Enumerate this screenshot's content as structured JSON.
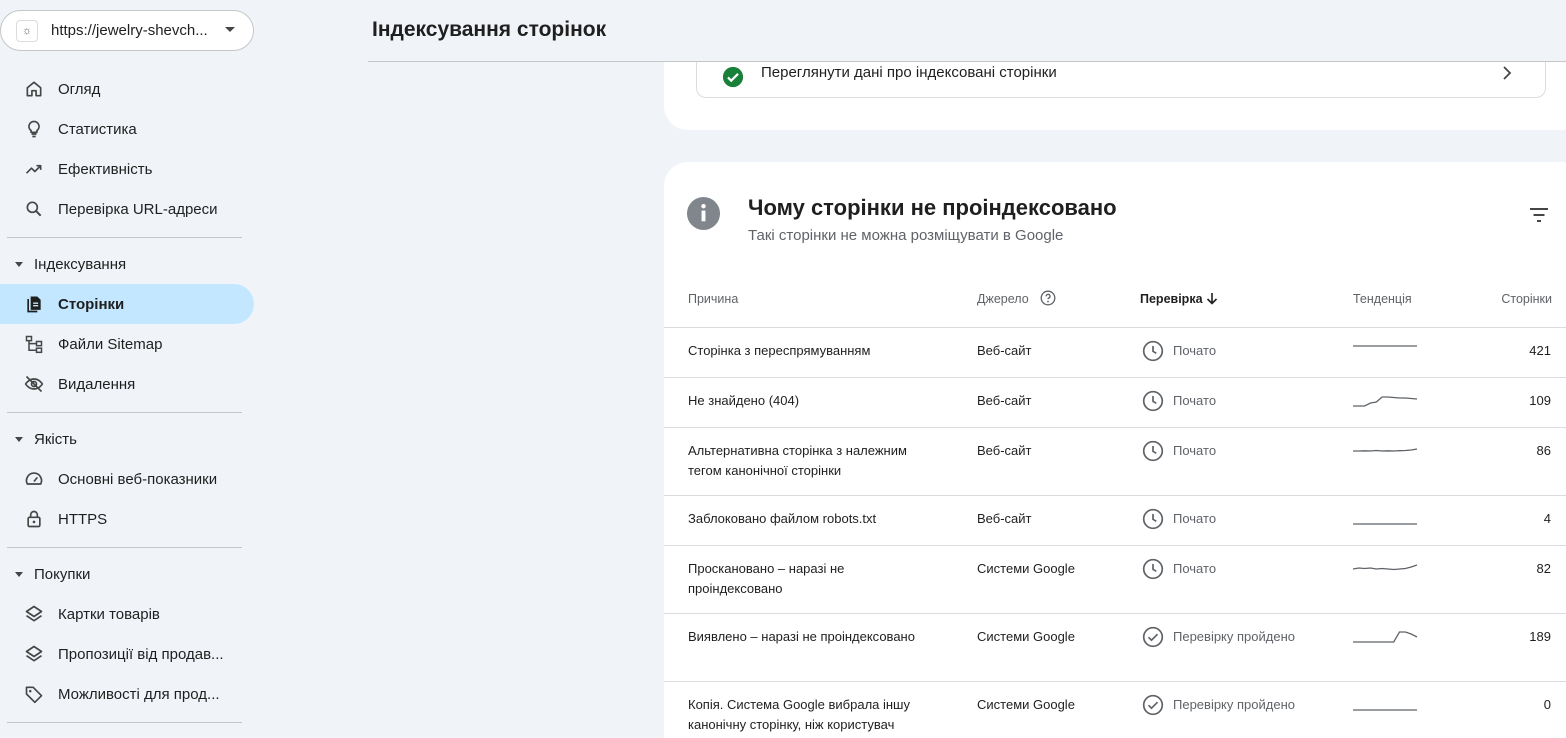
{
  "property": {
    "url": "https://jewelry-shevch...",
    "favicon": "☼"
  },
  "sidebar": {
    "items": [
      {
        "label": "Огляд",
        "icon": "home-icon"
      },
      {
        "label": "Статистика",
        "icon": "lightbulb-icon"
      },
      {
        "label": "Ефективність",
        "icon": "trending-up-icon"
      },
      {
        "label": "Перевірка URL-адреси",
        "icon": "search-icon"
      }
    ],
    "sections": [
      {
        "label": "Індексування",
        "items": [
          {
            "label": "Сторінки",
            "icon": "pages-icon",
            "active": true
          },
          {
            "label": "Файли Sitemap",
            "icon": "sitemap-icon"
          },
          {
            "label": "Видалення",
            "icon": "visibility-off-icon"
          }
        ]
      },
      {
        "label": "Якість",
        "items": [
          {
            "label": "Основні веб-показники",
            "icon": "speed-icon"
          },
          {
            "label": "HTTPS",
            "icon": "lock-icon"
          }
        ]
      },
      {
        "label": "Покупки",
        "items": [
          {
            "label": "Картки товарів",
            "icon": "layers-icon"
          },
          {
            "label": "Пропозиції від продав...",
            "icon": "layers-icon"
          },
          {
            "label": "Можливості для прод...",
            "icon": "tag-icon"
          }
        ]
      }
    ]
  },
  "header": {
    "title": "Індексування сторінок"
  },
  "indexed_link": {
    "label": "Переглянути дані про індексовані сторінки"
  },
  "not_indexed": {
    "title": "Чому сторінки не проіндексовано",
    "subtitle": "Такі сторінки не можна розміщувати в Google",
    "columns": {
      "reason": "Причина",
      "source": "Джерело",
      "check": "Перевірка",
      "trend": "Тенденція",
      "pages": "Сторінки"
    },
    "rows": [
      {
        "reason": "Сторінка з переспрямуванням",
        "source": "Веб-сайт",
        "check": "Почато",
        "status": "started",
        "pages": "421",
        "trend": [
          1,
          1,
          1,
          1,
          1,
          1,
          1,
          1,
          1,
          1,
          1,
          1
        ]
      },
      {
        "reason": "Не знайдено (404)",
        "source": "Веб-сайт",
        "check": "Почато",
        "status": "started",
        "pages": "109",
        "trend": [
          0,
          0,
          0,
          0.3,
          0.4,
          0.9,
          0.9,
          0.85,
          0.8,
          0.8,
          0.75,
          0.7
        ]
      },
      {
        "reason": "Альтернативна сторінка з належним тегом канонічної сторінки",
        "source": "Веб-сайт",
        "check": "Почато",
        "status": "started",
        "pages": "86",
        "trend": [
          0.5,
          0.5,
          0.52,
          0.5,
          0.55,
          0.5,
          0.52,
          0.5,
          0.53,
          0.55,
          0.6,
          0.7
        ]
      },
      {
        "reason": "Заблоковано файлом robots.txt",
        "source": "Веб-сайт",
        "check": "Почато",
        "status": "started",
        "pages": "4",
        "trend": [
          0,
          0,
          0,
          0,
          0,
          0,
          0,
          0,
          0,
          0,
          0,
          0
        ]
      },
      {
        "reason": "Проскановано – наразі не проіндексовано",
        "source": "Системи Google",
        "check": "Почато",
        "status": "started",
        "pages": "82",
        "trend": [
          0.5,
          0.6,
          0.55,
          0.6,
          0.5,
          0.55,
          0.5,
          0.45,
          0.5,
          0.55,
          0.7,
          0.9
        ]
      },
      {
        "reason": "Виявлено – наразі не проіндексовано",
        "source": "Системи Google",
        "check": "Перевірку пройдено",
        "status": "passed",
        "pages": "189",
        "trend": [
          0,
          0,
          0,
          0,
          0,
          0,
          0,
          0,
          1,
          1,
          0.8,
          0.5
        ]
      },
      {
        "reason": "Копія. Система Google вибрала іншу канонічну сторінку, ніж користувач",
        "source": "Системи Google",
        "check": "Перевірку пройдено",
        "status": "passed",
        "pages": "0",
        "trend": [
          0,
          0,
          0,
          0,
          0,
          0,
          0,
          0,
          0,
          0,
          0,
          0
        ]
      }
    ]
  },
  "colors": {
    "active_nav": "#c2e7ff",
    "check_green": "#188038",
    "info_grey": "#80868b",
    "spark": "#5f6368"
  }
}
